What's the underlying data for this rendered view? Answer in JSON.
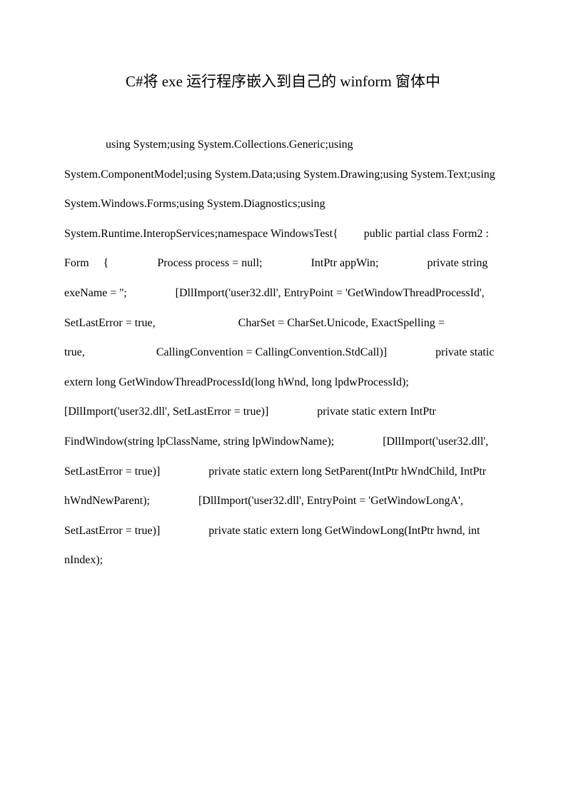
{
  "title": "C#将 exe 运行程序嵌入到自己的 winform 窗体中",
  "body": "using System;using System.Collections.Generic;using System.ComponentModel;using System.Data;using System.Drawing;using System.Text;using System.Windows.Forms;using System.Diagnostics;using System.Runtime.InteropServices;namespace WindowsTest{   public partial class Form2 : Form  {     Process process = null;     IntPtr appWin;     private string exeName = '';     [DllImport('user32.dll', EntryPoint = 'GetWindowThreadProcessId', SetLastError = true,        CharSet = CharSet.Unicode, ExactSpelling = true,       CallingConvention = CallingConvention.StdCall)]     private static extern long GetWindowThreadProcessId(long hWnd, long lpdwProcessId);      [DllImport('user32.dll', SetLastError = true)]     private static extern IntPtr FindWindow(string lpClassName, string lpWindowName);     [DllImport('user32.dll', SetLastError = true)]     private static extern long SetParent(IntPtr hWndChild, IntPtr hWndNewParent);     [DllImport('user32.dll', EntryPoint = 'GetWindowLongA', SetLastError = true)]     private static extern long GetWindowLong(IntPtr hwnd, int nIndex);"
}
